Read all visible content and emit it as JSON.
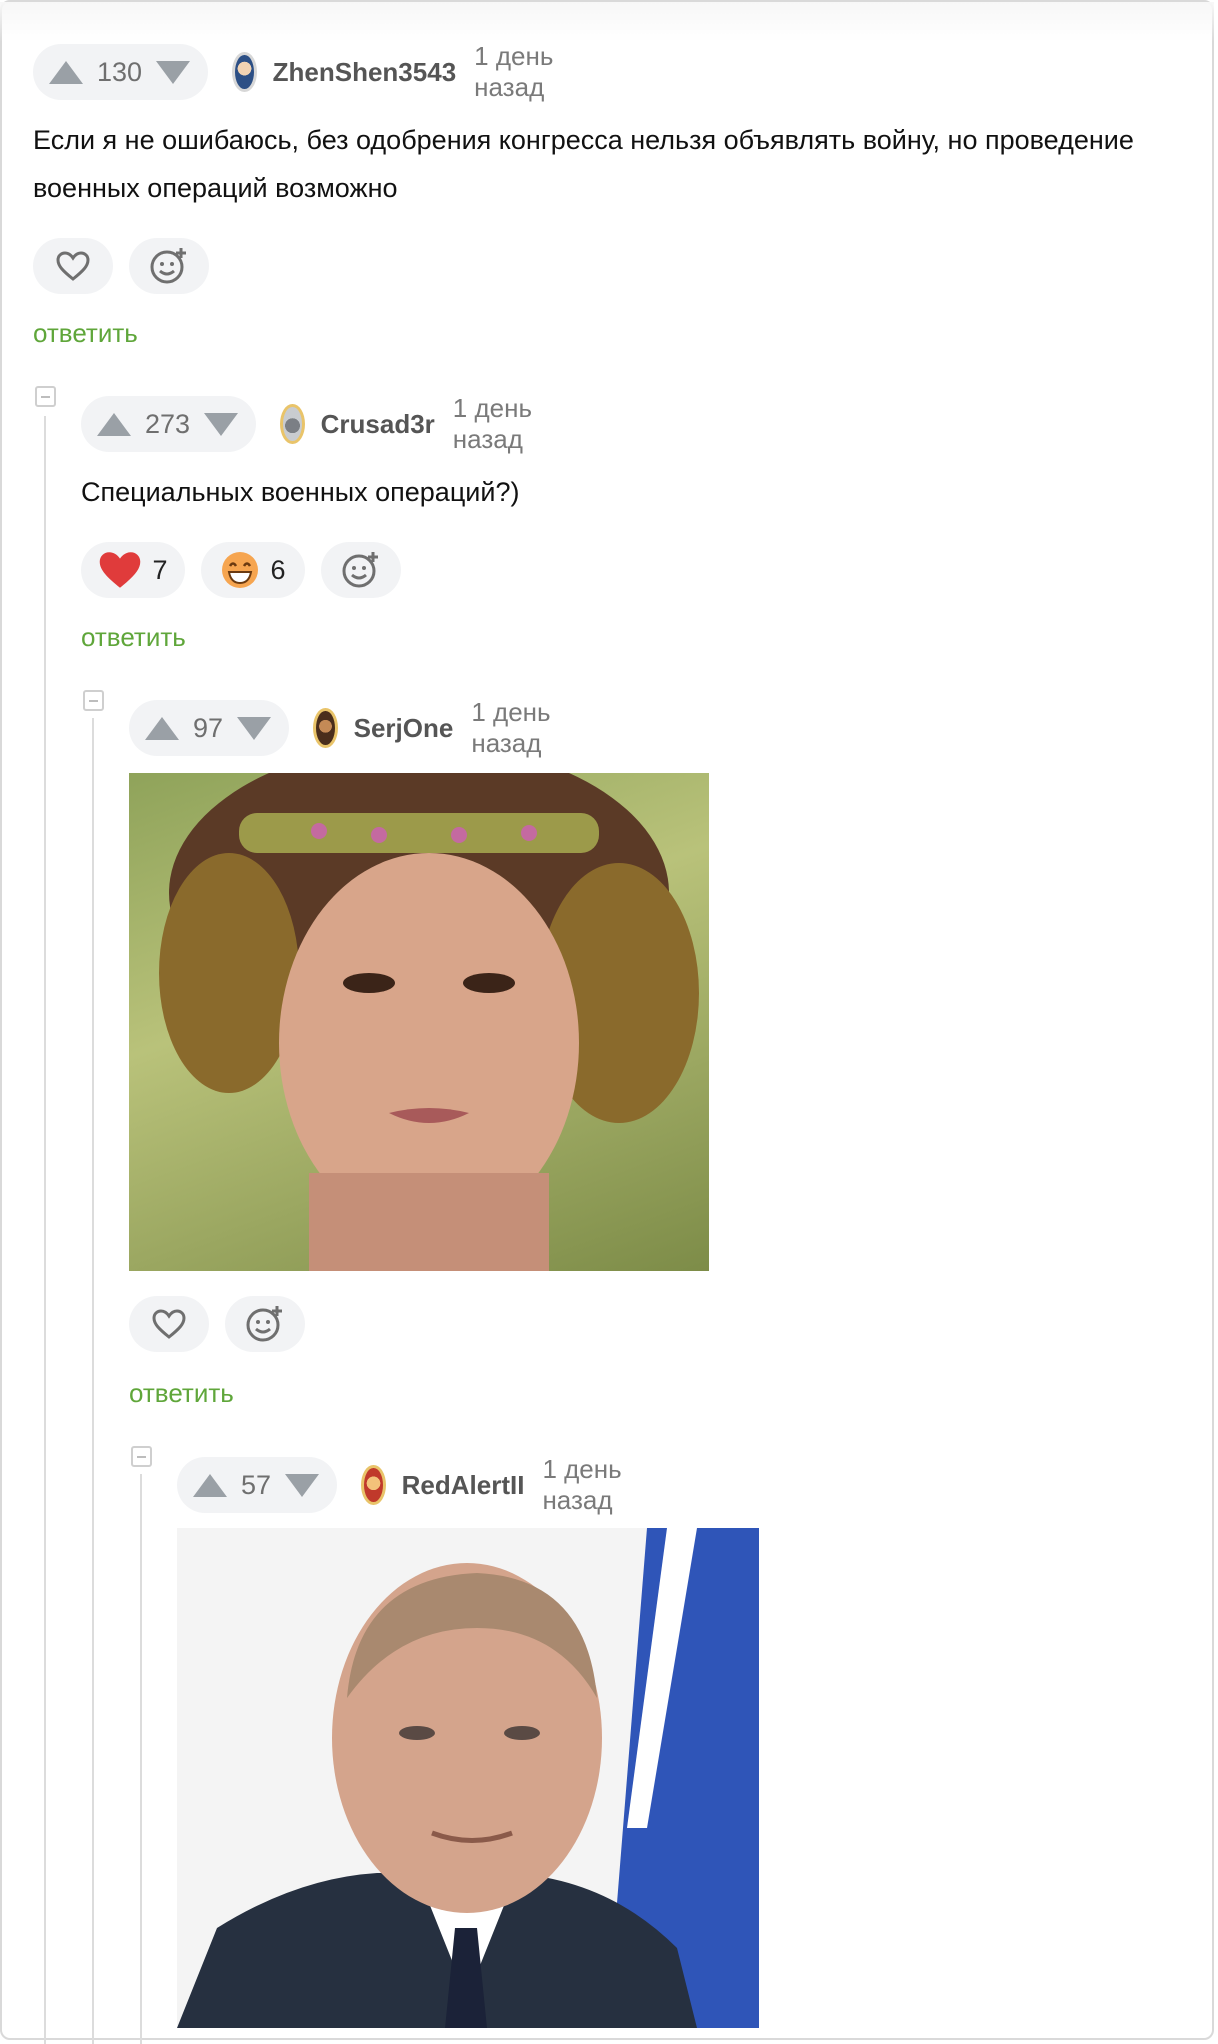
{
  "reply_label": "ответить",
  "colors": {
    "accent_green": "#5fa63a",
    "vote_bg": "#f2f3f5",
    "arrow": "#9aa0a6",
    "heart_red": "#e03b3b"
  },
  "comments": [
    {
      "score": "130",
      "author": "ZhenShen3543",
      "time": "1 день назад",
      "text_lines": [
        "Если я не ошибаюсь, без одобрения конгресса нельзя объявлять войну, но проведение",
        "военных операций возможно"
      ],
      "reactions": []
    },
    {
      "score": "273",
      "author": "Crusad3r",
      "time": "1 день назад",
      "text_lines": [
        "Специальных военных операций?)"
      ],
      "reactions": [
        {
          "icon": "red-heart-icon",
          "count": "7"
        },
        {
          "icon": "grinning-face-icon",
          "count": "6"
        }
      ]
    },
    {
      "score": "97",
      "author": "SerjOne",
      "time": "1 день назад",
      "image": "photo-woman-with-headband",
      "reactions": []
    },
    {
      "score": "57",
      "author": "RedAlertII",
      "time": "1 день назад",
      "image": "photo-man-in-suit"
    }
  ]
}
